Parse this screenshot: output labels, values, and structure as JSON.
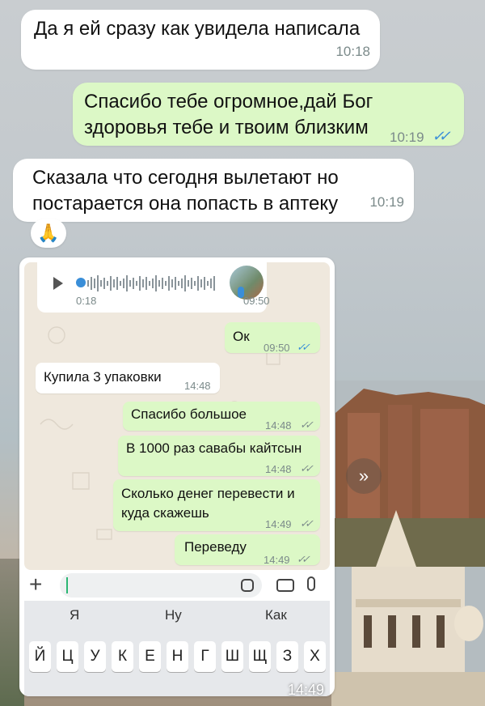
{
  "messages": [
    {
      "dir": "in",
      "text": "Да я ей сразу как увидела написала",
      "time": "10:18"
    },
    {
      "dir": "out",
      "text": "Спасибо тебе огромное,дай Бог здоровья тебе и твоим близким",
      "time": "10:19"
    },
    {
      "dir": "in",
      "text": "Сказала что сегодня вылетают но постарается она попасть в аптеку",
      "time": "10:19"
    }
  ],
  "reaction": "🙏",
  "screenshot": {
    "voice": {
      "duration": "0:18",
      "time": "09:50"
    },
    "messages": [
      {
        "dir": "out",
        "text": "Ок",
        "time": "09:50",
        "read": true
      },
      {
        "dir": "in",
        "text": "Купила 3 упаковки",
        "time": "14:48"
      },
      {
        "dir": "out",
        "text": "Спасибо большое",
        "time": "14:48",
        "read": false
      },
      {
        "dir": "out",
        "text": "В 1000 раз савабы кайтсын",
        "time": "14:48",
        "read": false
      },
      {
        "dir": "out",
        "text": "Сколько денег перевести и куда скажешь",
        "time": "14:49",
        "read": false
      },
      {
        "dir": "out",
        "text": "Переведу",
        "time": "14:49",
        "read": false
      }
    ],
    "input": {
      "plus": "+",
      "value": ""
    },
    "keyboard": {
      "suggestions": [
        "Я",
        "Ну",
        "Как"
      ],
      "row1": [
        "Й",
        "Ц",
        "У",
        "К",
        "Е",
        "Н",
        "Г",
        "Ш",
        "Щ",
        "З",
        "Х"
      ]
    },
    "overlay_time": "14:49"
  },
  "forward_icon": "forward-icon",
  "colors": {
    "incoming": "#ffffff",
    "outgoing": "#dcf8c6",
    "read_ticks": "#3a8ed8"
  }
}
